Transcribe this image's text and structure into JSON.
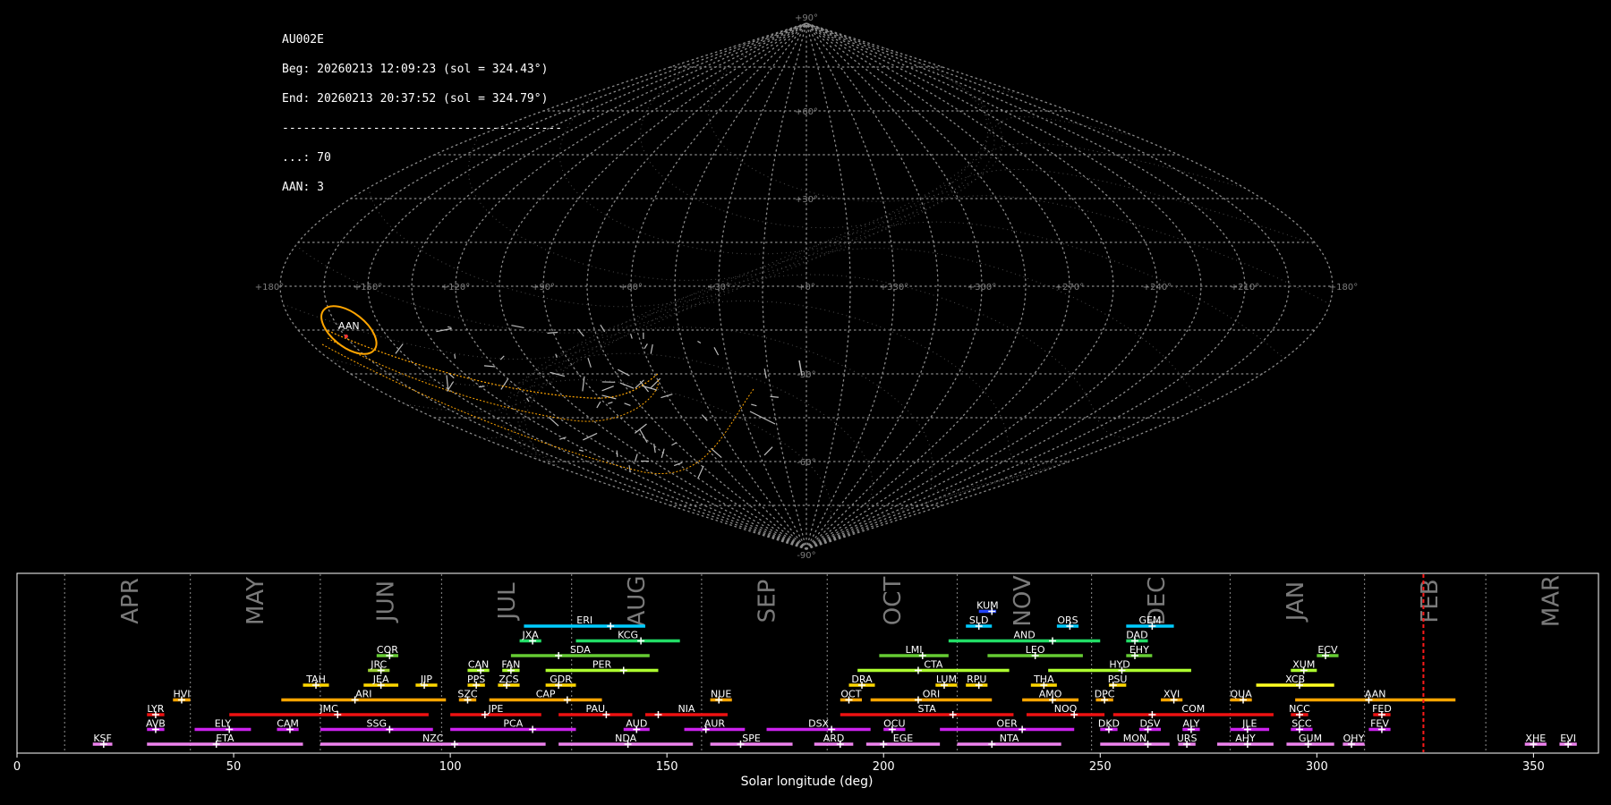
{
  "info": {
    "camera": "AU002E",
    "beg": "Beg: 20260213 12:09:23 (sol = 324.43°)",
    "end": "End: 20260213 20:37:52 (sol = 324.79°)",
    "sep": "----------------------------------------",
    "count_line": "...: 70",
    "aan_line": "AAN: 3"
  },
  "sky_map": {
    "projection": "sinusoidal",
    "lon_labels": [
      "+180°",
      "+150°",
      "+120°",
      "+90°",
      "+60°",
      "+30°",
      "+0°",
      "+330°",
      "+300°",
      "+270°",
      "+240°",
      "+210°",
      "+180°"
    ],
    "lat_labels": [
      "+90°",
      "+60°",
      "+30°",
      "-30°",
      "-60°",
      "-90°"
    ],
    "lon_values": [
      180,
      150,
      120,
      90,
      60,
      30,
      0,
      -30,
      -60,
      -90,
      -120,
      -150,
      -180
    ],
    "lat_values": [
      90,
      60,
      30,
      -30,
      -60,
      -90
    ],
    "highlight": {
      "label": "AAN",
      "color": "#ffa500",
      "lon": 162,
      "lat": -15
    }
  },
  "chart_data": {
    "type": "timeline",
    "xlabel": "Solar longitude (deg)",
    "xlim": [
      0,
      365
    ],
    "xticks": [
      0,
      50,
      100,
      150,
      200,
      250,
      300,
      350
    ],
    "current_sol": 324.6,
    "months": [
      {
        "label": "APR",
        "sol": 11
      },
      {
        "label": "MAY",
        "sol": 40
      },
      {
        "label": "JUN",
        "sol": 70
      },
      {
        "label": "JUL",
        "sol": 98
      },
      {
        "label": "AUG",
        "sol": 128
      },
      {
        "label": "SEP",
        "sol": 158
      },
      {
        "label": "OCT",
        "sol": 187
      },
      {
        "label": "NOV",
        "sol": 217
      },
      {
        "label": "DEC",
        "sol": 248
      },
      {
        "label": "JAN",
        "sol": 280
      },
      {
        "label": "FEB",
        "sol": 311
      },
      {
        "label": "MAR",
        "sol": 339
      }
    ],
    "showers": [
      {
        "code": "KSF",
        "start": 17.5,
        "end": 22,
        "peak": 20,
        "row": 0,
        "color": "#ee82ee"
      },
      {
        "code": "ETA",
        "start": 30,
        "end": 66,
        "peak": 46,
        "row": 0,
        "color": "#ee82ee"
      },
      {
        "code": "NZC",
        "start": 70,
        "end": 122,
        "peak": 101,
        "row": 0,
        "color": "#ee82ee"
      },
      {
        "code": "NDA",
        "start": 125,
        "end": 156,
        "peak": 141,
        "row": 0,
        "color": "#ee82ee"
      },
      {
        "code": "SPE",
        "start": 160,
        "end": 179,
        "peak": 167,
        "row": 0,
        "color": "#ee82ee"
      },
      {
        "code": "ARD",
        "start": 184,
        "end": 193,
        "peak": 190,
        "row": 0,
        "color": "#ee82ee"
      },
      {
        "code": "EGE",
        "start": 196,
        "end": 213,
        "peak": 200,
        "row": 0,
        "color": "#ee82ee"
      },
      {
        "code": "NTA",
        "start": 217,
        "end": 241,
        "peak": 225,
        "row": 0,
        "color": "#ee82ee"
      },
      {
        "code": "MON",
        "start": 250,
        "end": 266,
        "peak": 261,
        "row": 0,
        "color": "#ee82ee"
      },
      {
        "code": "URS",
        "start": 268,
        "end": 272,
        "peak": 270,
        "row": 0,
        "color": "#ee82ee"
      },
      {
        "code": "AHY",
        "start": 277,
        "end": 290,
        "peak": 284,
        "row": 0,
        "color": "#ee82ee"
      },
      {
        "code": "GUM",
        "start": 293,
        "end": 304,
        "peak": 298,
        "row": 0,
        "color": "#ee82ee"
      },
      {
        "code": "OHY",
        "start": 306,
        "end": 311,
        "peak": 308,
        "row": 0,
        "color": "#ee82ee"
      },
      {
        "code": "XHE",
        "start": 348,
        "end": 353,
        "peak": 350,
        "row": 0,
        "color": "#ee82ee"
      },
      {
        "code": "EVI",
        "start": 356,
        "end": 360,
        "peak": 358,
        "row": 0,
        "color": "#ee82ee"
      },
      {
        "code": "AVB",
        "start": 30,
        "end": 34,
        "peak": 32,
        "row": 1,
        "color": "#cc22ee"
      },
      {
        "code": "ELY",
        "start": 41,
        "end": 54,
        "peak": 49,
        "row": 1,
        "color": "#cc22ee"
      },
      {
        "code": "CAM",
        "start": 60,
        "end": 65,
        "peak": 63,
        "row": 1,
        "color": "#cc22ee"
      },
      {
        "code": "SSG",
        "start": 70,
        "end": 96,
        "peak": 86,
        "row": 1,
        "color": "#cc22ee"
      },
      {
        "code": "PCA",
        "start": 100,
        "end": 129,
        "peak": 119,
        "row": 1,
        "color": "#cc22ee"
      },
      {
        "code": "AUD",
        "start": 140,
        "end": 146,
        "peak": 143,
        "row": 1,
        "color": "#cc22ee"
      },
      {
        "code": "AUR",
        "start": 154,
        "end": 168,
        "peak": 159,
        "row": 1,
        "color": "#cc22ee"
      },
      {
        "code": "DSX",
        "start": 173,
        "end": 197,
        "peak": 188,
        "row": 1,
        "color": "#cc22ee"
      },
      {
        "code": "OCU",
        "start": 200,
        "end": 205,
        "peak": 202,
        "row": 1,
        "color": "#cc22ee"
      },
      {
        "code": "OER",
        "start": 213,
        "end": 244,
        "peak": 232,
        "row": 1,
        "color": "#cc22ee"
      },
      {
        "code": "DKD",
        "start": 250,
        "end": 254,
        "peak": 252,
        "row": 1,
        "color": "#cc22ee"
      },
      {
        "code": "DSV",
        "start": 259,
        "end": 264,
        "peak": 261,
        "row": 1,
        "color": "#cc22ee"
      },
      {
        "code": "ALY",
        "start": 269,
        "end": 273,
        "peak": 271,
        "row": 1,
        "color": "#cc22ee"
      },
      {
        "code": "JLE",
        "start": 280,
        "end": 289,
        "peak": 284,
        "row": 1,
        "color": "#cc22ee"
      },
      {
        "code": "SCC",
        "start": 294,
        "end": 299,
        "peak": 296,
        "row": 1,
        "color": "#cc22ee"
      },
      {
        "code": "FEV",
        "start": 312,
        "end": 317,
        "peak": 315,
        "row": 1,
        "color": "#cc22ee"
      },
      {
        "code": "LYR",
        "start": 30,
        "end": 34,
        "peak": 32,
        "row": 2,
        "color": "#ee1111"
      },
      {
        "code": "JMC",
        "start": 49,
        "end": 95,
        "peak": 74,
        "row": 2,
        "color": "#ee1111"
      },
      {
        "code": "JPE",
        "start": 100,
        "end": 121,
        "peak": 108,
        "row": 2,
        "color": "#ee1111"
      },
      {
        "code": "PAU",
        "start": 125,
        "end": 142,
        "peak": 136,
        "row": 2,
        "color": "#ee1111"
      },
      {
        "code": "NIA",
        "start": 145,
        "end": 164,
        "peak": 148,
        "row": 2,
        "color": "#ee1111"
      },
      {
        "code": "STA",
        "start": 190,
        "end": 230,
        "peak": 216,
        "row": 2,
        "color": "#ee1111"
      },
      {
        "code": "NOO",
        "start": 233,
        "end": 251,
        "peak": 244,
        "row": 2,
        "color": "#ee1111"
      },
      {
        "code": "COM",
        "start": 253,
        "end": 290,
        "peak": 262,
        "row": 2,
        "color": "#ee1111"
      },
      {
        "code": "NCC",
        "start": 294,
        "end": 298,
        "peak": 296,
        "row": 2,
        "color": "#ee1111"
      },
      {
        "code": "FED",
        "start": 313,
        "end": 317,
        "peak": 315,
        "row": 2,
        "color": "#ee1111"
      },
      {
        "code": "HVI",
        "start": 36,
        "end": 40,
        "peak": 38,
        "row": 3,
        "color": "#ffa500"
      },
      {
        "code": "ARI",
        "start": 61,
        "end": 99,
        "peak": 78,
        "row": 3,
        "color": "#ffa500"
      },
      {
        "code": "SZC",
        "start": 102,
        "end": 106,
        "peak": 104,
        "row": 3,
        "color": "#ffa500"
      },
      {
        "code": "CAP",
        "start": 109,
        "end": 135,
        "peak": 127,
        "row": 3,
        "color": "#ffa500"
      },
      {
        "code": "NUE",
        "start": 160,
        "end": 165,
        "peak": 162,
        "row": 3,
        "color": "#ffa500"
      },
      {
        "code": "OCT",
        "start": 190,
        "end": 195,
        "peak": 192,
        "row": 3,
        "color": "#ffa500"
      },
      {
        "code": "ORI",
        "start": 197,
        "end": 225,
        "peak": 208,
        "row": 3,
        "color": "#ffa500"
      },
      {
        "code": "AMO",
        "start": 232,
        "end": 245,
        "peak": 239,
        "row": 3,
        "color": "#ffa500"
      },
      {
        "code": "DPC",
        "start": 249,
        "end": 253,
        "peak": 251,
        "row": 3,
        "color": "#ffa500"
      },
      {
        "code": "XVI",
        "start": 264,
        "end": 269,
        "peak": 267,
        "row": 3,
        "color": "#ffa500"
      },
      {
        "code": "QUA",
        "start": 280,
        "end": 285,
        "peak": 283,
        "row": 3,
        "color": "#ffa500"
      },
      {
        "code": "AAN",
        "start": 295,
        "end": 332,
        "peak": 312,
        "row": 3,
        "color": "#ffa500"
      },
      {
        "code": "TAH",
        "start": 66,
        "end": 72,
        "peak": 69,
        "row": 4,
        "color": "#ffd700"
      },
      {
        "code": "JEA",
        "start": 80,
        "end": 88,
        "peak": 84,
        "row": 4,
        "color": "#ffd700"
      },
      {
        "code": "JIP",
        "start": 92,
        "end": 97,
        "peak": 94,
        "row": 4,
        "color": "#ffd700"
      },
      {
        "code": "PPS",
        "start": 104,
        "end": 108,
        "peak": 106,
        "row": 4,
        "color": "#ffd700"
      },
      {
        "code": "ZCS",
        "start": 111,
        "end": 116,
        "peak": 113,
        "row": 4,
        "color": "#ffd700"
      },
      {
        "code": "GDR",
        "start": 122,
        "end": 129,
        "peak": 125,
        "row": 4,
        "color": "#ffd700"
      },
      {
        "code": "DRA",
        "start": 192,
        "end": 198,
        "peak": 195,
        "row": 4,
        "color": "#ffd700"
      },
      {
        "code": "LUM",
        "start": 212,
        "end": 217,
        "peak": 214,
        "row": 4,
        "color": "#ffd700"
      },
      {
        "code": "RPU",
        "start": 219,
        "end": 224,
        "peak": 222,
        "row": 4,
        "color": "#ffd700"
      },
      {
        "code": "THA",
        "start": 234,
        "end": 240,
        "peak": 237,
        "row": 4,
        "color": "#ffd700"
      },
      {
        "code": "PSU",
        "start": 252,
        "end": 256,
        "peak": 253,
        "row": 4,
        "color": "#ffd700"
      },
      {
        "code": "XCB",
        "start": 286,
        "end": 304,
        "peak": 296,
        "row": 4,
        "color": "#ffff22"
      },
      {
        "code": "JRC",
        "start": 81,
        "end": 86,
        "peak": 84,
        "row": 5,
        "color": "#9acd32"
      },
      {
        "code": "CAN",
        "start": 104,
        "end": 109,
        "peak": 107,
        "row": 5,
        "color": "#adff2f"
      },
      {
        "code": "FAN",
        "start": 112,
        "end": 116,
        "peak": 114,
        "row": 5,
        "color": "#adff2f"
      },
      {
        "code": "PER",
        "start": 122,
        "end": 148,
        "peak": 140,
        "row": 5,
        "color": "#adff2f"
      },
      {
        "code": "CTA",
        "start": 194,
        "end": 229,
        "peak": 208,
        "row": 5,
        "color": "#adff2f"
      },
      {
        "code": "HYD",
        "start": 238,
        "end": 271,
        "peak": 255,
        "row": 5,
        "color": "#adff2f"
      },
      {
        "code": "XUM",
        "start": 294,
        "end": 300,
        "peak": 297,
        "row": 5,
        "color": "#adff2f"
      },
      {
        "code": "COR",
        "start": 83,
        "end": 88,
        "peak": 86,
        "row": 6,
        "color": "#66cc33"
      },
      {
        "code": "SDA",
        "start": 114,
        "end": 146,
        "peak": 125,
        "row": 6,
        "color": "#66cc33"
      },
      {
        "code": "LMI",
        "start": 199,
        "end": 215,
        "peak": 209,
        "row": 6,
        "color": "#66cc33"
      },
      {
        "code": "LEO",
        "start": 224,
        "end": 246,
        "peak": 235,
        "row": 6,
        "color": "#66cc33"
      },
      {
        "code": "EHY",
        "start": 256,
        "end": 262,
        "peak": 258,
        "row": 6,
        "color": "#66cc33"
      },
      {
        "code": "ECV",
        "start": 300,
        "end": 305,
        "peak": 302,
        "row": 6,
        "color": "#66cc33"
      },
      {
        "code": "JXA",
        "start": 116,
        "end": 121,
        "peak": 119,
        "row": 7,
        "color": "#22dd66"
      },
      {
        "code": "KCG",
        "start": 129,
        "end": 153,
        "peak": 144,
        "row": 7,
        "color": "#22dd66"
      },
      {
        "code": "AND",
        "start": 215,
        "end": 250,
        "peak": 239,
        "row": 7,
        "color": "#22dd66"
      },
      {
        "code": "DAD",
        "start": 256,
        "end": 261,
        "peak": 258,
        "row": 7,
        "color": "#22dd66"
      },
      {
        "code": "ERI",
        "start": 117,
        "end": 145,
        "peak": 137,
        "row": 8,
        "color": "#00ccff"
      },
      {
        "code": "SLD",
        "start": 219,
        "end": 225,
        "peak": 222,
        "row": 8,
        "color": "#00ccff"
      },
      {
        "code": "ORS",
        "start": 240,
        "end": 245,
        "peak": 243,
        "row": 8,
        "color": "#00ccff"
      },
      {
        "code": "GEM",
        "start": 256,
        "end": 267,
        "peak": 262,
        "row": 8,
        "color": "#00ccff"
      },
      {
        "code": "KUM",
        "start": 222,
        "end": 226,
        "peak": 225,
        "row": 9,
        "color": "#2244ff"
      }
    ]
  }
}
